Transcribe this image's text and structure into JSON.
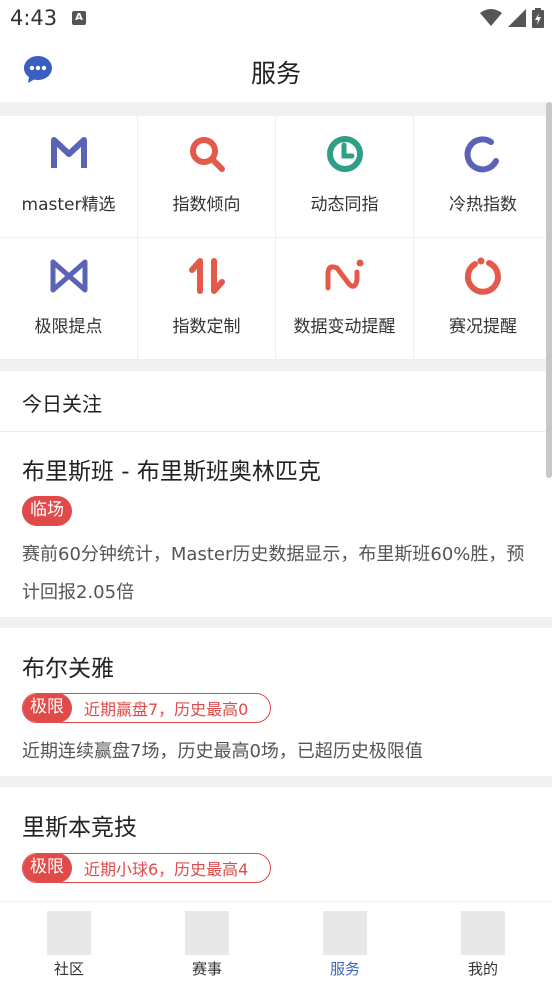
{
  "status_bar": {
    "time": "4:43",
    "notification_letter": "A"
  },
  "header": {
    "title": "服务"
  },
  "grid": [
    {
      "label": "master精选",
      "icon": "m-letter-icon",
      "color": "#5a63b5"
    },
    {
      "label": "指数倾向",
      "icon": "magnifier-icon",
      "color": "#e35a4b"
    },
    {
      "label": "动态同指",
      "icon": "clock-icon",
      "color": "#2e9e86"
    },
    {
      "label": "冷热指数",
      "icon": "open-ring-icon",
      "color": "#5a63b5"
    },
    {
      "label": "极限提点",
      "icon": "bowtie-icon",
      "color": "#5a63b5"
    },
    {
      "label": "指数定制",
      "icon": "up-down-arrows-icon",
      "color": "#e35a4b"
    },
    {
      "label": "数据变动提醒",
      "icon": "wave-icon",
      "color": "#e35a4b"
    },
    {
      "label": "赛况提醒",
      "icon": "power-ring-icon",
      "color": "#e35a4b"
    }
  ],
  "section": {
    "title": "今日关注"
  },
  "cards": [
    {
      "title": "布里斯班 - 布里斯班奥林匹克",
      "badge": "临场",
      "description": "赛前60分钟统计，Master历史数据显示，布里斯班60%胜，预计回报2.05倍"
    },
    {
      "title": "布尔关雅",
      "badge": "极限",
      "badge_note": "近期赢盘7，历史最高0",
      "description": "近期连续赢盘7场，历史最高0场，已超历史极限值"
    },
    {
      "title": "里斯本竞技",
      "badge": "极限",
      "badge_note": "近期小球6，历史最高4"
    }
  ],
  "tabs": [
    {
      "label": "社区",
      "active": false
    },
    {
      "label": "赛事",
      "active": false
    },
    {
      "label": "服务",
      "active": true
    },
    {
      "label": "我的",
      "active": false
    }
  ],
  "colors": {
    "accent_blue": "#3a66c4",
    "accent_red": "#e04a4a",
    "brand_indigo": "#5a63b5",
    "green": "#2e9e86"
  }
}
